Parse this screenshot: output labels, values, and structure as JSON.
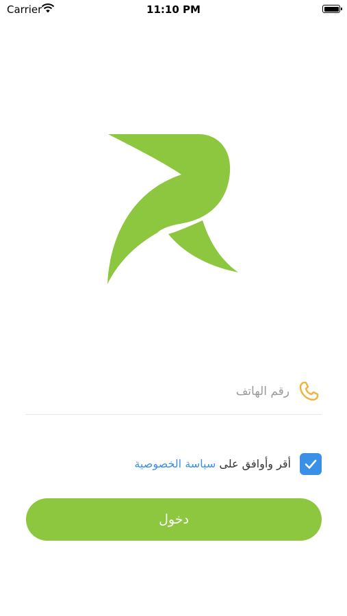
{
  "status_bar": {
    "carrier": "Carrier",
    "time": "11:10 PM",
    "icons": [
      "wifi-icon",
      "battery-icon"
    ]
  },
  "logo": {
    "icon": "brand-logo-r",
    "color": "#8dc63f"
  },
  "phone_field": {
    "placeholder": "رقم الهاتف",
    "value": "",
    "icon": "phone-icon",
    "icon_color": "#f0b43c"
  },
  "consent": {
    "checked": true,
    "text": "أقر وأوافق على",
    "link_text": "سياسة الخصوصية",
    "link_color": "#3a8fe6"
  },
  "login_button": {
    "label": "دخول",
    "color": "#8dc63f"
  }
}
